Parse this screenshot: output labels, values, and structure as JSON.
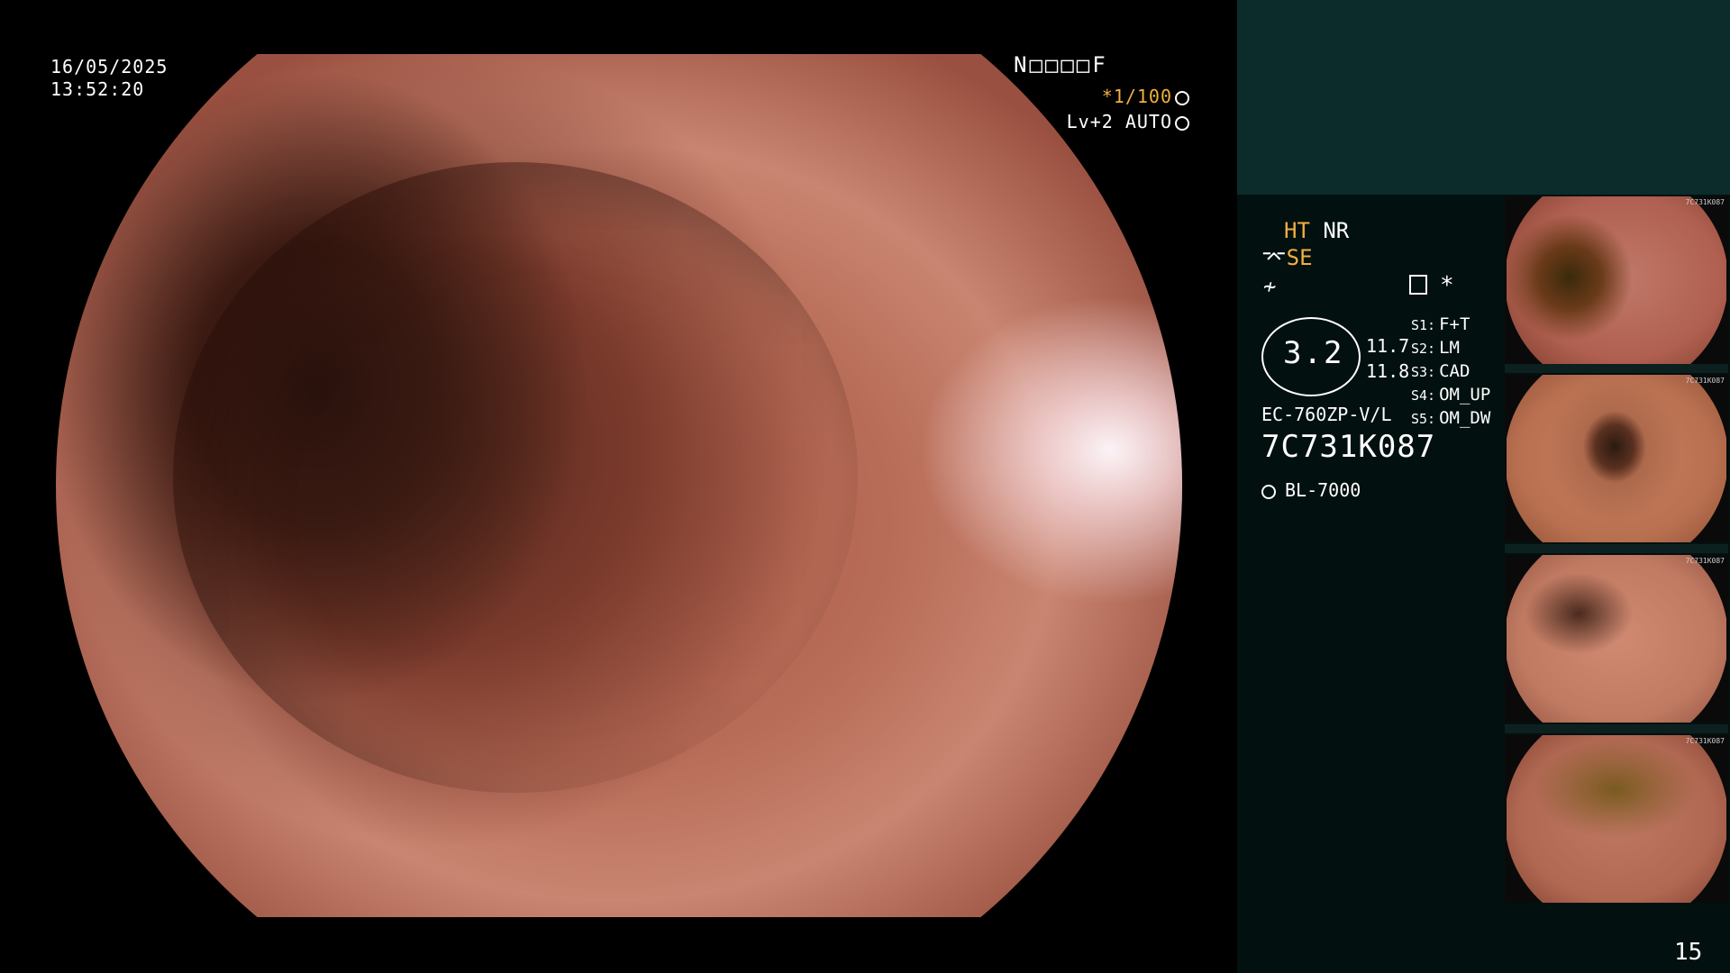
{
  "osd": {
    "date": "16/05/2025",
    "time": "13:52:20",
    "mode_code": "N□□□□F",
    "shutter": "*1/100",
    "level": "Lv+2 AUTO"
  },
  "side": {
    "ht": "HT",
    "nr": "NR",
    "se": "SE",
    "gauge_value": "3.2",
    "gauge_num1": "11.7",
    "gauge_num2": "11.8",
    "settings": [
      {
        "key": "S1:",
        "value": "F+T"
      },
      {
        "key": "S2:",
        "value": "LM"
      },
      {
        "key": "S3:",
        "value": "CAD"
      },
      {
        "key": "S4:",
        "value": "OM_UP"
      },
      {
        "key": "S5:",
        "value": "OM_DW"
      }
    ],
    "model": "EC-760ZP-V/L",
    "serial": "7C731K087",
    "light_source": "BL-7000"
  },
  "thumbnails": [
    {
      "caption": "7C731K087"
    },
    {
      "caption": "7C731K087"
    },
    {
      "caption": "7C731K087"
    },
    {
      "caption": "7C731K087"
    }
  ],
  "page_number": "15",
  "colors": {
    "panel_bg": "#021010",
    "panel_top_bg": "#0c2b2b",
    "accent_yellow": "#f0b040"
  }
}
